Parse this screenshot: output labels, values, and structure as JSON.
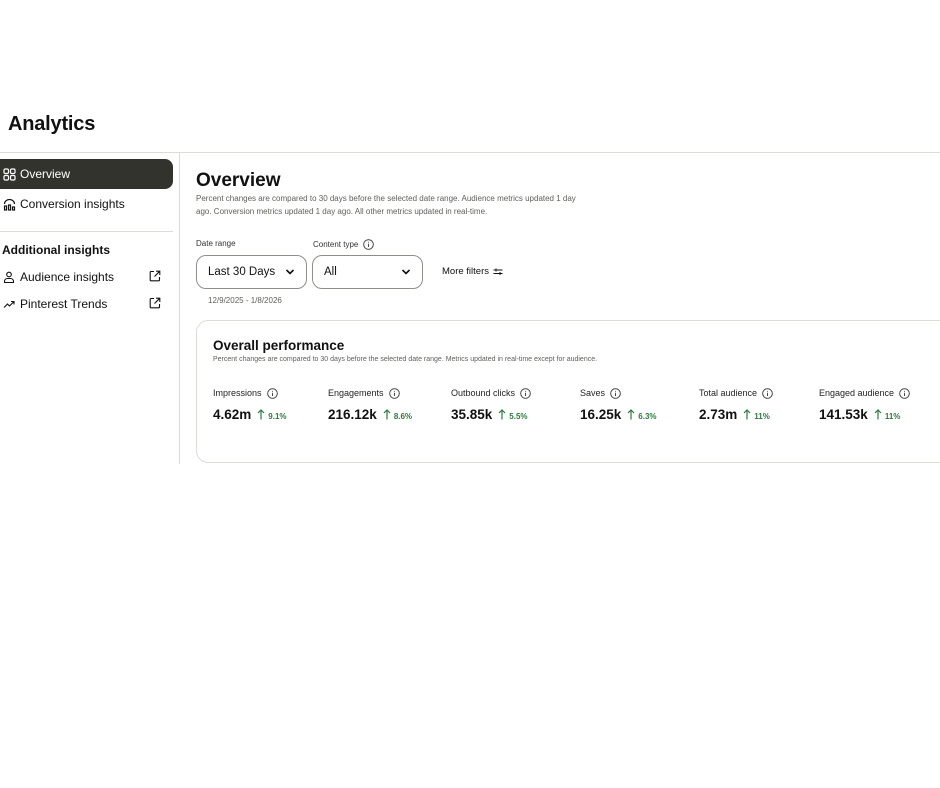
{
  "header": {
    "title": "Analytics"
  },
  "sidebar": {
    "items": [
      {
        "label": "Overview",
        "icon": "grid-icon",
        "active": true
      },
      {
        "label": "Conversion insights",
        "icon": "conversion-icon",
        "active": false
      }
    ],
    "section_heading": "Additional insights",
    "additional_items": [
      {
        "label": "Audience insights",
        "icon": "person-icon",
        "trailing_icon": "external-link-icon"
      },
      {
        "label": "Pinterest Trends",
        "icon": "trend-icon",
        "trailing_icon": "external-link-icon"
      }
    ]
  },
  "main": {
    "title": "Overview",
    "subtitle": "Percent changes are compared to 30 days before the selected date range. Audience metrics updated 1 day ago. Conversion metrics updated 1 day ago. All other metrics updated in real-time.",
    "filters": {
      "date_range_label": "Date range",
      "date_range_value": "Last 30 Days",
      "content_type_label": "Content type",
      "content_type_value": "All",
      "more_filters_label": "More filters",
      "date_range_text": "12/9/2025 - 1/8/2026"
    },
    "performance": {
      "title": "Overall performance",
      "subtitle": "Percent changes are compared to 30 days before the selected date range. Metrics updated in real-time except for audience.",
      "metrics": [
        {
          "label": "Impressions",
          "value": "4.62m",
          "change": "9.1%"
        },
        {
          "label": "Engagements",
          "value": "216.12k",
          "change": "8.6%"
        },
        {
          "label": "Outbound clicks",
          "value": "35.85k",
          "change": "5.5%"
        },
        {
          "label": "Saves",
          "value": "16.25k",
          "change": "6.3%"
        },
        {
          "label": "Total audience",
          "value": "2.73m",
          "change": "11%"
        },
        {
          "label": "Engaged audience",
          "value": "141.53k",
          "change": "11%"
        }
      ]
    }
  },
  "colors": {
    "active_nav_bg": "#33332d",
    "positive_change": "#2b7a3d",
    "divider": "#dcdcd6"
  }
}
